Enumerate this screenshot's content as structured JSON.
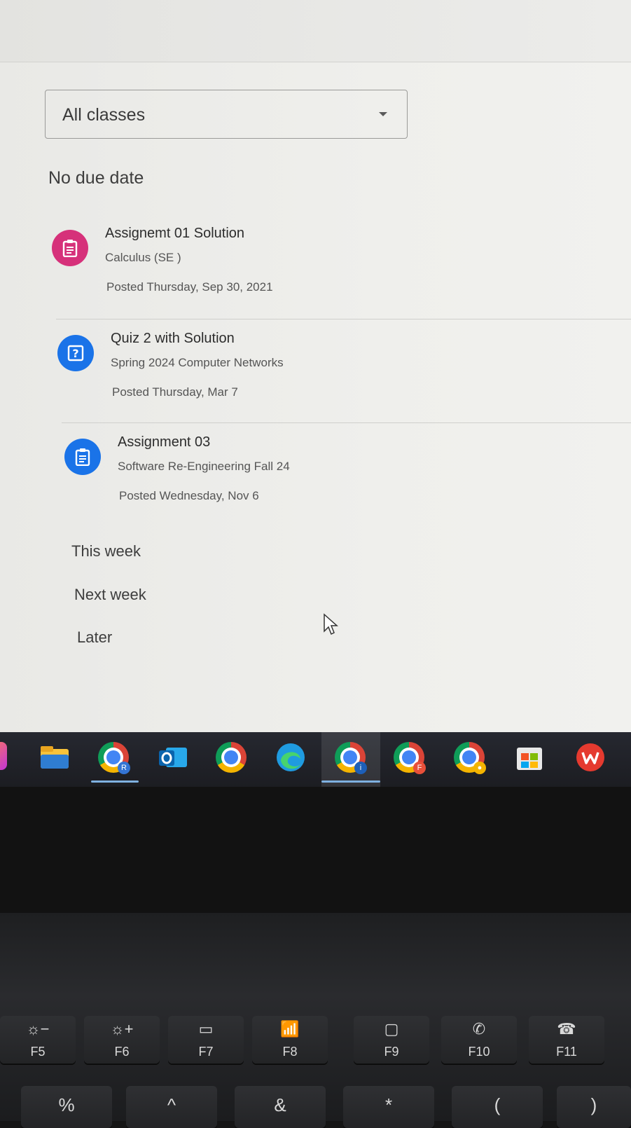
{
  "filter": {
    "selected": "All classes"
  },
  "sections": {
    "no_due_date": "No due date",
    "this_week": "This week",
    "next_week": "Next week",
    "later": "Later"
  },
  "tasks": [
    {
      "title": "Assignemt 01 Solution",
      "course": "Calculus (SE )",
      "posted": "Posted Thursday, Sep 30, 2021",
      "icon": "assignment-icon",
      "color": "#d6317a"
    },
    {
      "title": "Quiz 2 with Solution",
      "course": "Spring 2024 Computer Networks",
      "posted": "Posted Thursday, Mar 7",
      "icon": "quiz-icon",
      "color": "#1a73e8"
    },
    {
      "title": "Assignment 03",
      "course": "Software Re-Engineering Fall 24",
      "posted": "Posted Wednesday, Nov 6",
      "icon": "assignment-icon",
      "color": "#1a73e8"
    }
  ],
  "taskbar": {
    "apps": [
      "file-explorer-icon",
      "chrome-profile-r-icon",
      "outlook-icon",
      "chrome-icon",
      "edge-icon",
      "chrome-profile-i-icon",
      "chrome-profile-f-icon",
      "chrome-profile-person-icon",
      "microsoft-store-icon",
      "wps-office-icon"
    ],
    "badges": {
      "r": "R",
      "i": "i",
      "f": "F"
    }
  },
  "keyboard": {
    "fn_keys": [
      "F5",
      "F6",
      "F7",
      "F8",
      "F9",
      "F10",
      "F11"
    ],
    "fn_glyphs": [
      "☼−",
      "☼+",
      "▭",
      "📶",
      "▢",
      "✆",
      "☎"
    ],
    "number_row": [
      "%",
      "^",
      "&",
      "*",
      "(",
      ")"
    ]
  }
}
